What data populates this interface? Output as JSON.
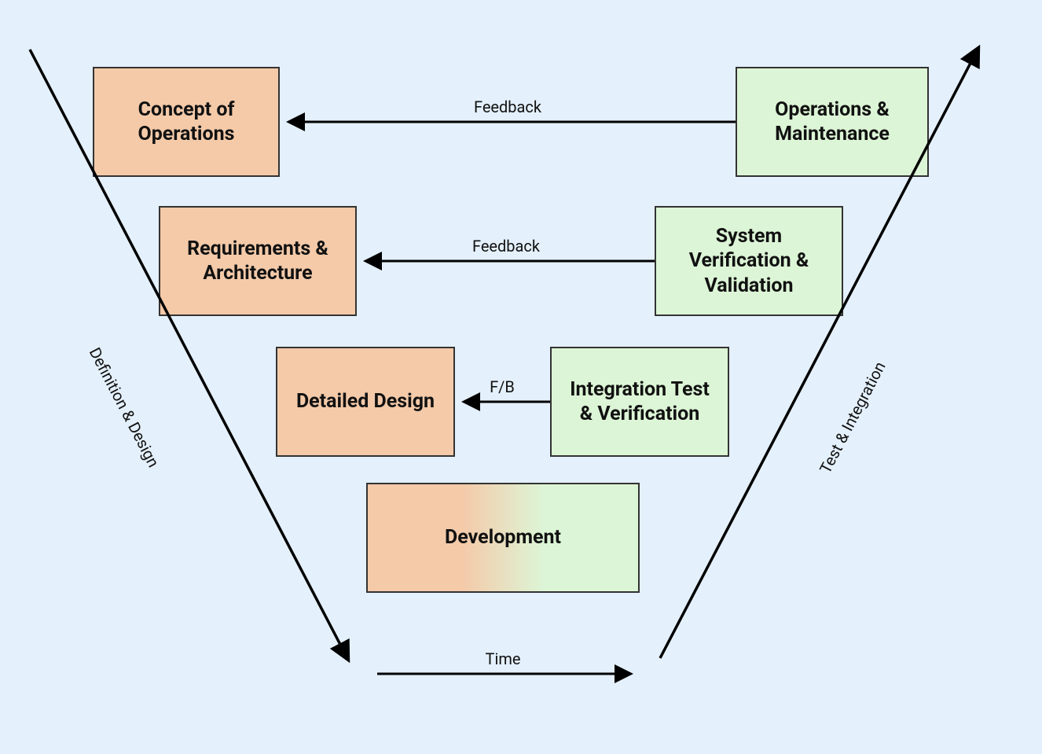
{
  "boxes": {
    "concept": "Concept of Operations",
    "requirements": "Requirements & Architecture",
    "design": "Detailed Design",
    "development": "Development",
    "integration": "Integration Test & Verification",
    "system": "System Verification & Validation",
    "operations": "Operations & Maintenance"
  },
  "arrows": {
    "feedback1": "Feedback",
    "feedback2": "Feedback",
    "feedback3": "F/B",
    "time": "Time"
  },
  "axes": {
    "left": "Definition & Design",
    "right": "Test & Integration"
  }
}
